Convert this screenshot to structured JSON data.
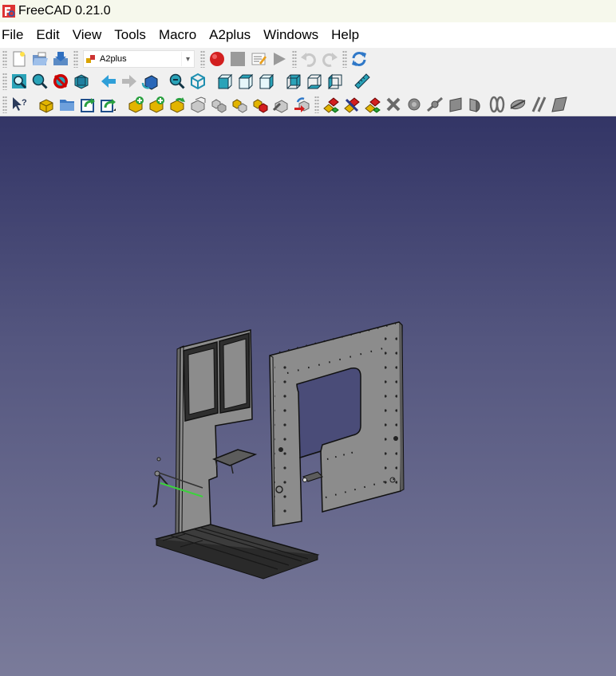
{
  "window": {
    "title": "FreeCAD 0.21.0"
  },
  "menu": [
    "File",
    "Edit",
    "View",
    "Tools",
    "Macro",
    "A2plus",
    "Windows",
    "Help"
  ],
  "workbench": {
    "selected": "A2plus"
  },
  "colors": {
    "viewport_top": "#333566",
    "viewport_bottom": "#7a7b9a",
    "part_face": "#8c8c8c",
    "selection_green": "#3cd23c",
    "macro_record_red": "#d21f1f"
  },
  "toolbars": {
    "file": [
      "new-document-icon",
      "open-folder-icon",
      "save-icon"
    ],
    "macro": [
      "macro-record-icon",
      "macro-stop-icon",
      "macro-edit-icon",
      "macro-run-icon"
    ],
    "history": [
      "undo-icon",
      "redo-icon",
      "refresh-icon"
    ],
    "view": [
      "fit-all-icon",
      "fit-selection-icon",
      "draw-style-icon",
      "bounding-box-icon",
      "back-arrow-icon",
      "forward-arrow-icon",
      "sync-view-icon",
      "zoom-icon",
      "isometric-view-icon",
      "front-view-icon",
      "top-view-icon",
      "right-view-icon",
      "rear-view-icon",
      "bottom-view-icon",
      "left-view-icon",
      "measure-icon"
    ],
    "a2plus": [
      "whats-this-icon",
      "add-part-icon",
      "add-from-folder-icon",
      "update-imports-icon",
      "update-imports-recursive-icon",
      "import-part-icon",
      "import-shape-icon",
      "convert-part-icon",
      "duplicate-part-icon",
      "edit-part-icon",
      "move-part-icon",
      "fixed-part-icon",
      "flip-part-icon",
      "transfer-part-icon",
      "solve-constraints-icon",
      "solve-all-icon",
      "toggle-autosolve-icon",
      "delete-constraints-icon",
      "point-identity-icon",
      "point-on-line-icon",
      "plane-parallel-icon",
      "plane-coincident-icon",
      "axis-coincident-icon",
      "axis-parallel-icon",
      "angled-planes-icon",
      "center-of-mass-icon",
      "line-parallel-icon"
    ]
  }
}
